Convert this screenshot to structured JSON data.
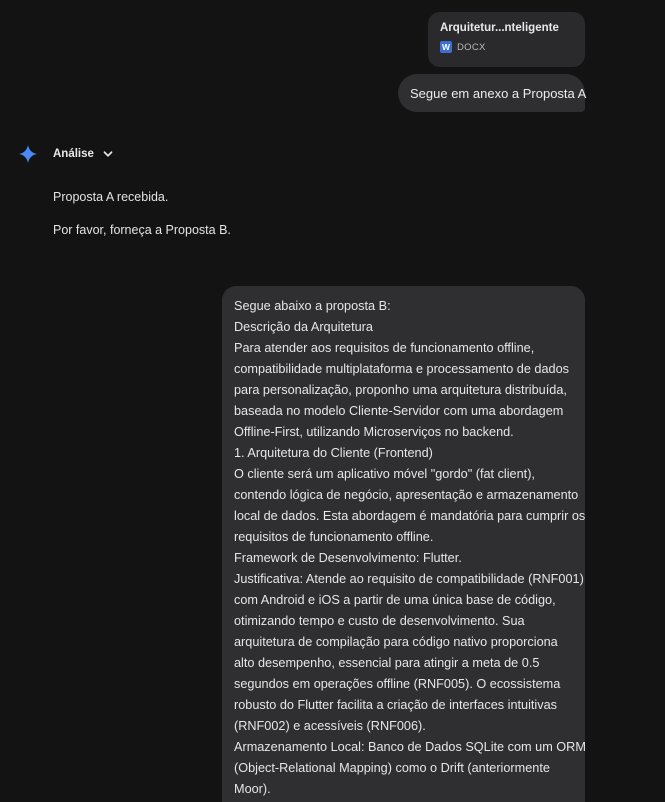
{
  "attachment": {
    "name": "Arquitetur...nteligente",
    "type": "DOCX",
    "icon": "word-doc-icon"
  },
  "user_message_1": "Segue em anexo a Proposta A",
  "model": {
    "name": "Análise",
    "icon": "gemini-spark-icon",
    "dropdown_icon": "chevron-down-icon",
    "accent": "#4a8af4"
  },
  "response": [
    "Proposta A recebida.",
    "Por favor, forneça a Proposta B."
  ],
  "user_message_2_lines": [
    "Segue abaixo a proposta B:",
    "Descrição da Arquitetura",
    "Para atender aos requisitos de funcionamento offline,",
    "compatibilidade multiplataforma e processamento de dados",
    "para personalização, proponho uma arquitetura distribuída,",
    "baseada no modelo Cliente-Servidor com uma abordagem",
    "Offline-First, utilizando Microserviços no backend.",
    "1. Arquitetura do Cliente (Frontend)",
    "O cliente será um aplicativo móvel \"gordo\" (fat client),",
    "contendo lógica de negócio, apresentação e armazenamento",
    "local de dados. Esta abordagem é mandatória para cumprir os",
    "requisitos de funcionamento offline.",
    "Framework de Desenvolvimento: Flutter.",
    "Justificativa: Atende ao requisito de compatibilidade (RNF001)",
    "com Android e iOS a partir de uma única base de código,",
    "otimizando tempo e custo de desenvolvimento. Sua",
    "arquitetura de compilação para código nativo proporciona",
    "alto desempenho, essencial para atingir a meta de 0.5",
    "segundos em operações offline (RNF005). O ecossistema",
    "robusto do Flutter facilita a criação de interfaces intuitivas",
    "(RNF002) e acessíveis (RNF006).",
    "Armazenamento Local: Banco de Dados SQLite com um ORM",
    "(Object-Relational Mapping) como o Drift (anteriormente",
    "Moor)."
  ]
}
